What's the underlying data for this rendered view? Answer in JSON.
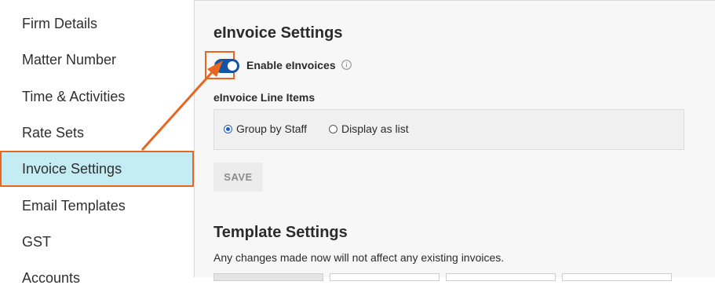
{
  "sidebar": {
    "items": [
      {
        "label": "Firm Details"
      },
      {
        "label": "Matter Number"
      },
      {
        "label": "Time & Activities"
      },
      {
        "label": "Rate Sets"
      },
      {
        "label": "Invoice Settings",
        "active": true
      },
      {
        "label": "Email Templates"
      },
      {
        "label": "GST"
      },
      {
        "label": "Accounts"
      }
    ]
  },
  "einvoice": {
    "title": "eInvoice Settings",
    "toggle_label": "Enable eInvoices",
    "toggle_on": true,
    "line_items_label": "eInvoice Line Items",
    "options": [
      {
        "label": "Group by Staff",
        "checked": true
      },
      {
        "label": "Display as list",
        "checked": false
      }
    ],
    "save_label": "SAVE"
  },
  "template": {
    "title": "Template Settings",
    "helper": "Any changes made now will not affect any existing invoices."
  },
  "colors": {
    "accent": "#1354a7",
    "active_nav_bg": "#c3ecf3",
    "annotation": "#e8661f"
  }
}
